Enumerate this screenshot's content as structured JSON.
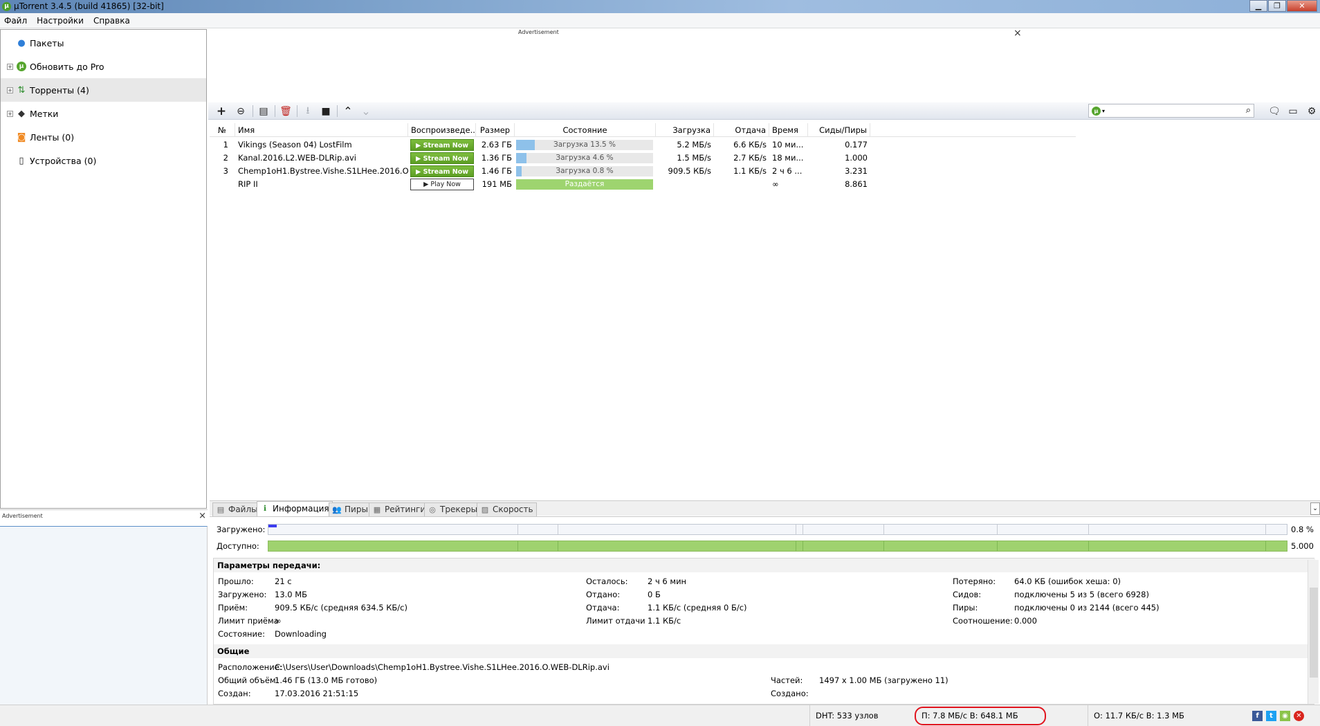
{
  "window": {
    "title": "µTorrent 3.4.5  (build 41865) [32-bit]",
    "app_icon": "µ",
    "minimize": "▁",
    "maximize": "❐",
    "close": "✕"
  },
  "menu": [
    "Файл",
    "Настройки",
    "Справка"
  ],
  "sidebar": {
    "items": [
      {
        "label": "Пакеты",
        "icon": "bundle-icon",
        "glyph": "●",
        "expandable": false,
        "selected": false
      },
      {
        "label": "Обновить до Pro",
        "icon": "utorrent-logo-icon",
        "glyph": "µ",
        "expandable": true,
        "selected": false
      },
      {
        "label": "Торренты (4)",
        "icon": "torrents-icon",
        "glyph": "⇅",
        "expandable": true,
        "selected": true
      },
      {
        "label": "Метки",
        "icon": "label-tag-icon",
        "glyph": "◆",
        "expandable": true,
        "selected": false
      },
      {
        "label": "Ленты (0)",
        "icon": "rss-feed-icon",
        "glyph": "◙",
        "expandable": false,
        "selected": false
      },
      {
        "label": "Устройства (0)",
        "icon": "device-icon",
        "glyph": "▯",
        "expandable": false,
        "selected": false
      }
    ],
    "expander_glyph": "+",
    "ad_label": "Advertisement",
    "ad_close": "×"
  },
  "top_ad": {
    "label": "Advertisement",
    "close": "×"
  },
  "toolbar": {
    "buttons": [
      {
        "name": "add-torrent-button",
        "glyph": "+"
      },
      {
        "name": "add-link-button",
        "glyph": "⊖"
      },
      {
        "name": "create-torrent-button",
        "glyph": "▤"
      },
      {
        "name": "delete-button",
        "glyph": "🗑"
      },
      {
        "name": "start-download-button",
        "glyph": "⭳"
      },
      {
        "name": "stop-button",
        "glyph": "■"
      },
      {
        "name": "move-up-button",
        "glyph": "⌃"
      },
      {
        "name": "move-down-button",
        "glyph": "⌄"
      }
    ],
    "search_placeholder": "",
    "search_engine_glyph": "µ",
    "search_engine_arrow": "▾",
    "search_glyph": "⌕",
    "right_buttons": [
      {
        "name": "chat-icon",
        "glyph": "🗨"
      },
      {
        "name": "remote-screen-icon",
        "glyph": "▭"
      },
      {
        "name": "settings-gear-icon",
        "glyph": "⚙"
      }
    ],
    "accent_color": "#56a52e"
  },
  "torrent_table": {
    "columns": [
      "№",
      "Имя",
      "Воспроизведе...",
      "Размер",
      "Состояние",
      "Загрузка",
      "Отдача",
      "Время",
      "Сиды/Пиры"
    ],
    "rows": [
      {
        "num": "1",
        "name": "Vikings (Season 04) LostFilm",
        "play": "▶ Stream Now",
        "play_type": "stream",
        "size": "2.63 ГБ",
        "status": "Загрузка 13.5 %",
        "progress": 0.135,
        "seeding": false,
        "down": "5.2 МБ/s",
        "up": "6.6 КБ/s",
        "eta": "10 ми...",
        "ratio": "0.177"
      },
      {
        "num": "2",
        "name": "Kanal.2016.L2.WEB-DLRip.avi",
        "play": "▶ Stream Now",
        "play_type": "stream",
        "size": "1.36 ГБ",
        "status": "Загрузка 4.6 %",
        "progress": 0.046,
        "seeding": false,
        "down": "1.5 МБ/s",
        "up": "2.7 КБ/s",
        "eta": "18 ми...",
        "ratio": "1.000"
      },
      {
        "num": "3",
        "name": "Chemp1oH1.Bystree.Vishe.S1LHee.2016.O....",
        "play": "▶ Stream Now",
        "play_type": "stream",
        "size": "1.46 ГБ",
        "status": "Загрузка 0.8 %",
        "progress": 0.008,
        "seeding": false,
        "down": "909.5 КБ/s",
        "up": "1.1 КБ/s",
        "eta": "2 ч 6 ...",
        "ratio": "3.231"
      },
      {
        "num": "",
        "name": "RIP II",
        "play": "▶ Play Now",
        "play_type": "play",
        "size": "191 МБ",
        "status": "Раздаётся",
        "progress": 1.0,
        "seeding": true,
        "down": "",
        "up": "",
        "eta": "∞",
        "ratio": "8.861"
      }
    ]
  },
  "tabs": [
    {
      "label": "Файлы",
      "icon": "files-icon",
      "glyph": "▤",
      "active": false
    },
    {
      "label": "Информация",
      "icon": "info-icon",
      "glyph": "ℹ",
      "active": true
    },
    {
      "label": "Пиры",
      "icon": "peers-icon",
      "glyph": "👥",
      "active": false
    },
    {
      "label": "Рейтинги",
      "icon": "ratings-icon",
      "glyph": "▦",
      "active": false
    },
    {
      "label": "Трекеры",
      "icon": "trackers-icon",
      "glyph": "◎",
      "active": false
    },
    {
      "label": "Скорость",
      "icon": "speed-icon",
      "glyph": "▨",
      "active": false
    }
  ],
  "tabs_scroll_glyph": "⌄",
  "info": {
    "downloaded_label": "Загружено:",
    "downloaded_value": "0.8 %",
    "downloaded_fraction": 0.008,
    "available_label": "Доступно:",
    "available_value": "5.000",
    "transfer_heading": "Параметры передачи:",
    "transfer": {
      "col1": [
        {
          "label": "Прошло:",
          "value": "21 с"
        },
        {
          "label": "Загружено:",
          "value": "13.0 МБ"
        },
        {
          "label": "Приём:",
          "value": "909.5 КБ/с (средняя 634.5 КБ/с)"
        },
        {
          "label": "Лимит приёма",
          "value": "∞"
        },
        {
          "label": "Состояние:",
          "value": "Downloading"
        }
      ],
      "col2": [
        {
          "label": "Осталось:",
          "value": "2 ч 6 мин"
        },
        {
          "label": "Отдано:",
          "value": "0 Б"
        },
        {
          "label": "Отдача:",
          "value": "1.1 КБ/с (средняя 0 Б/с)"
        },
        {
          "label": "Лимит отдачи",
          "value": "1.1 КБ/с"
        }
      ],
      "col3": [
        {
          "label": "Потеряно:",
          "value": "64.0 КБ (ошибок хеша: 0)"
        },
        {
          "label": "Сидов:",
          "value": "подключены 5 из 5 (всего 6928)"
        },
        {
          "label": "Пиры:",
          "value": "подключены 0 из 2144 (всего 445)"
        },
        {
          "label": "Соотношение:",
          "value": "0.000"
        }
      ]
    },
    "general_heading": "Общие",
    "general": {
      "location_label": "Расположение:",
      "location_value": "C:\\Users\\User\\Downloads\\Chemp1oH1.Bystree.Vishe.S1LHee.2016.O.WEB-DLRip.avi",
      "total_label": "Общий объём:",
      "total_value": "1.46 ГБ (13.0 МБ готово)",
      "created_label": "Создан:",
      "created_value": "17.03.2016 21:51:15",
      "pieces_label": "Частей:",
      "pieces_value": "1497 x 1.00 МБ (загружено 11)",
      "created_by_label": "Создано:",
      "created_by_value": ""
    }
  },
  "statusbar": {
    "dht": "DHT: 533 узлов",
    "speed_in": "П: 7.8 МБ/с В: 648.1 МБ",
    "speed_out": "О: 11.7 КБ/с В: 1.3 МБ",
    "highlight_color": "#e0141e",
    "social": [
      {
        "name": "facebook-icon",
        "glyph": "f",
        "color": "#3b5998"
      },
      {
        "name": "twitter-icon",
        "glyph": "t",
        "color": "#1da1f2"
      },
      {
        "name": "android-icon",
        "glyph": "◉",
        "color": "#8bc34a"
      },
      {
        "name": "error-icon",
        "glyph": "✕",
        "color": "#d9251d"
      }
    ]
  }
}
